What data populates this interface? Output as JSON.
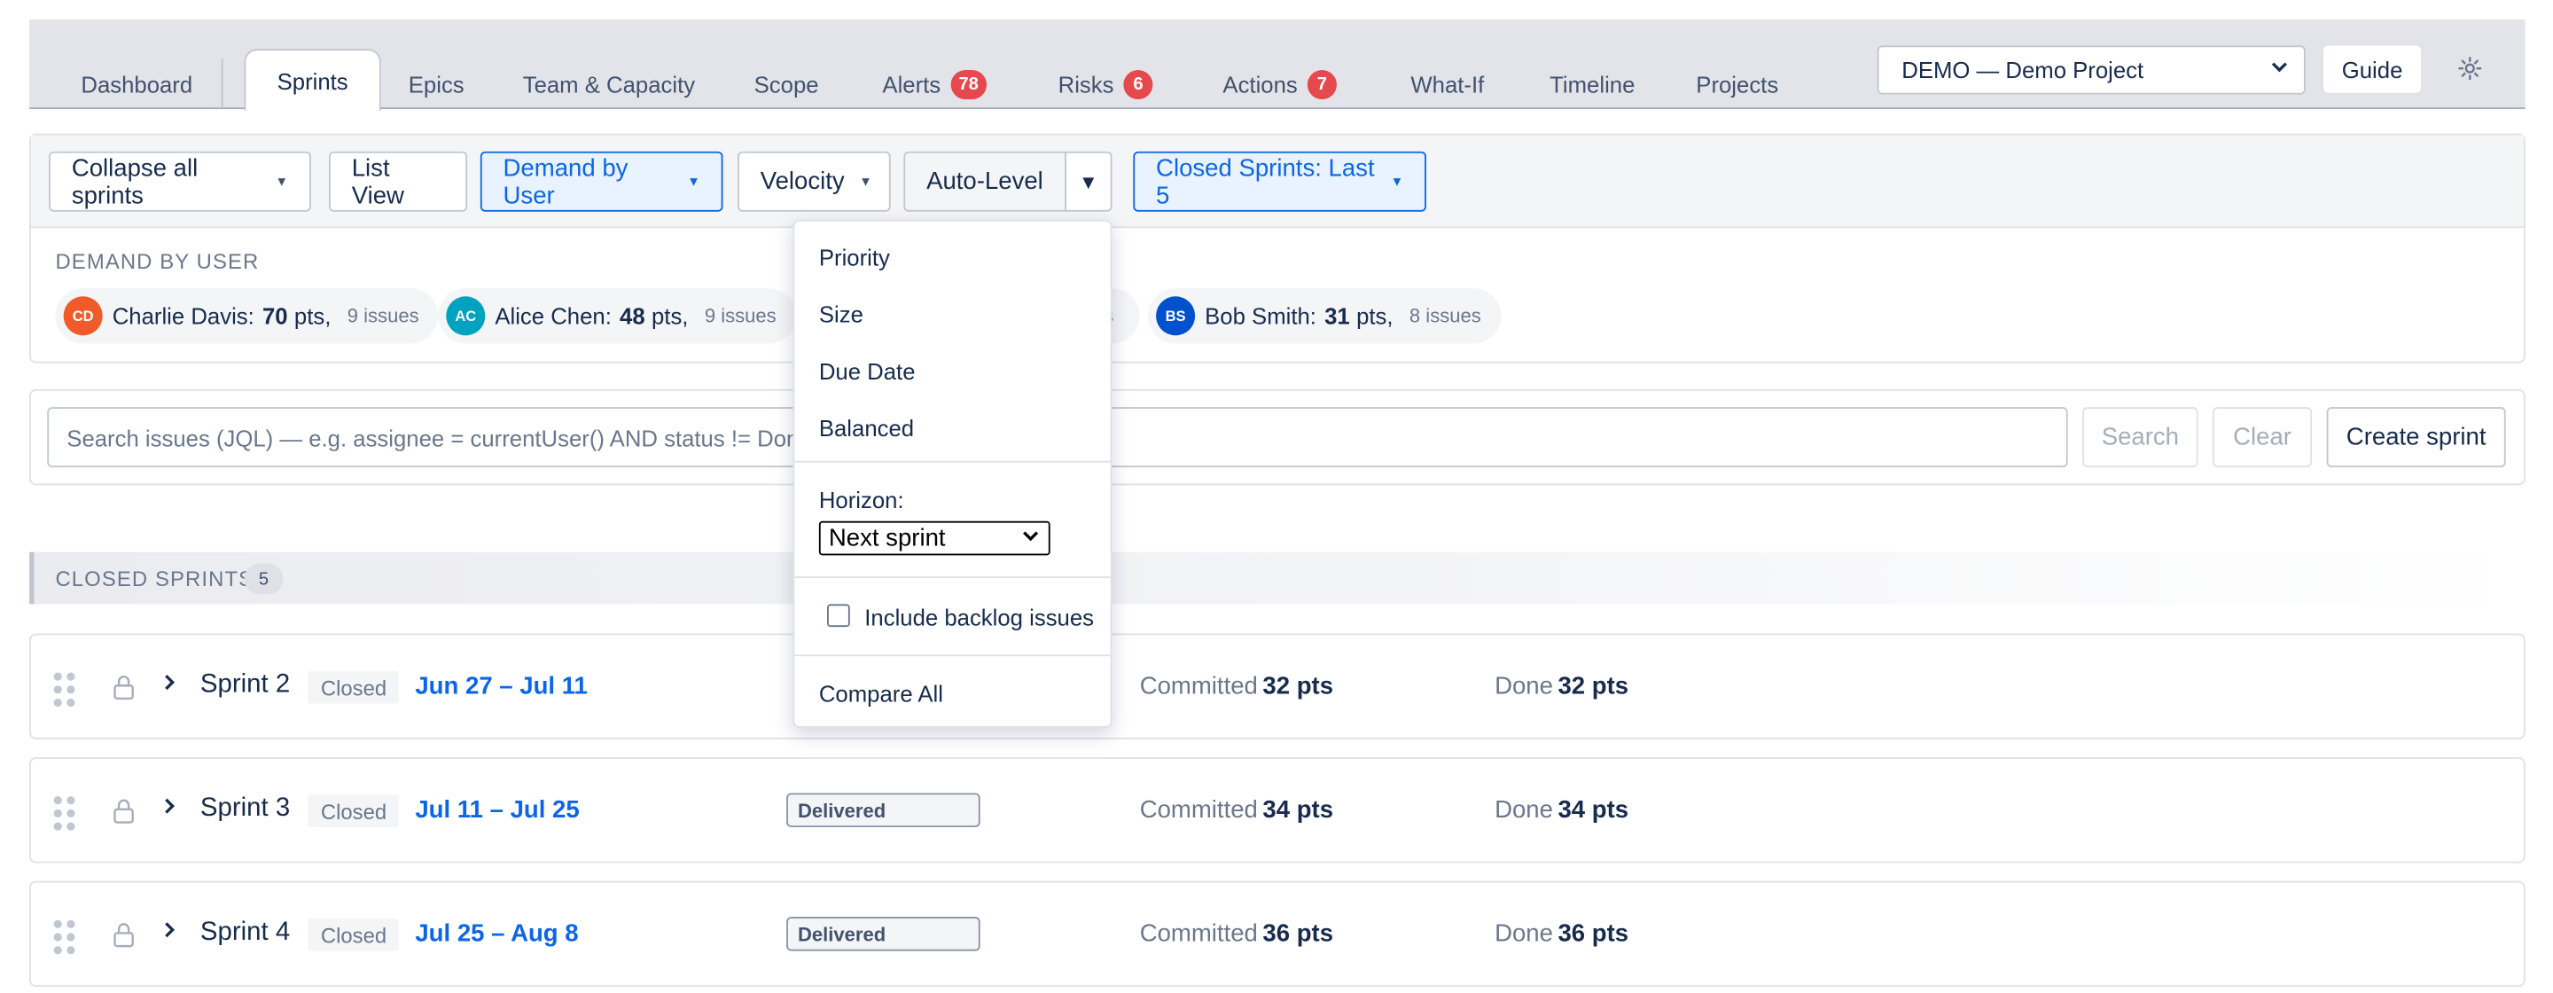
{
  "tabs": [
    {
      "label": "Dashboard",
      "badge": ""
    },
    {
      "label": "Sprints",
      "badge": ""
    },
    {
      "label": "Epics",
      "badge": ""
    },
    {
      "label": "Team & Capacity",
      "badge": ""
    },
    {
      "label": "Scope",
      "badge": ""
    },
    {
      "label": "Alerts",
      "badge": "78"
    },
    {
      "label": "Risks",
      "badge": "6"
    },
    {
      "label": "Actions",
      "badge": "7"
    },
    {
      "label": "What-If",
      "badge": ""
    },
    {
      "label": "Timeline",
      "badge": ""
    },
    {
      "label": "Projects",
      "badge": ""
    }
  ],
  "active_tab": "Sprints",
  "header": {
    "project_select": "DEMO — Demo Project",
    "guide_label": "Guide"
  },
  "toolbar": {
    "collapse_label": "Collapse all sprints",
    "list_view_label": "List View",
    "demand_label": "Demand by User",
    "velocity_label": "Velocity",
    "auto_level_label": "Auto-Level",
    "closed_sprints_label": "Closed Sprints: Last 5"
  },
  "demand": {
    "title": "DEMAND BY USER",
    "users": [
      {
        "initials": "CD",
        "name": "Charlie Davis:",
        "pts": "70",
        "unit": "pts,",
        "issues": "9 issues",
        "color": "#f15b2a"
      },
      {
        "initials": "AC",
        "name": "Alice Chen:",
        "pts": "48",
        "unit": "pts,",
        "issues": "9 issues",
        "color": "#00a3bf"
      },
      {
        "partial": "s"
      },
      {
        "initials": "BS",
        "name": "Bob Smith:",
        "pts": "31",
        "unit": "pts,",
        "issues": "8 issues",
        "color": "#0052cc"
      }
    ]
  },
  "search": {
    "placeholder": "Search issues (JQL) — e.g. assignee = currentUser() AND status != Done",
    "search_label": "Search",
    "clear_label": "Clear",
    "create_label": "Create sprint"
  },
  "closed_sprints": {
    "title": "CLOSED SPRINTS",
    "count": "5"
  },
  "sprints": [
    {
      "name": "Sprint 2",
      "status": "Closed",
      "dates": "Jun 27 – Jul 11",
      "badge": "",
      "committed_label": "Committed",
      "committed": "32 pts",
      "done_label": "Done",
      "done": "32 pts"
    },
    {
      "name": "Sprint 3",
      "status": "Closed",
      "dates": "Jul 11 – Jul 25",
      "badge": "Delivered",
      "committed_label": "Committed",
      "committed": "34 pts",
      "done_label": "Done",
      "done": "34 pts"
    },
    {
      "name": "Sprint 4",
      "status": "Closed",
      "dates": "Jul 25 – Aug 8",
      "badge": "Delivered",
      "committed_label": "Committed",
      "committed": "36 pts",
      "done_label": "Done",
      "done": "36 pts"
    }
  ],
  "menu": {
    "priority": "Priority",
    "size": "Size",
    "due_date": "Due Date",
    "balanced": "Balanced",
    "horizon_label": "Horizon:",
    "horizon_value": "Next sprint",
    "backlog_label": "Include backlog issues",
    "compare_all": "Compare All"
  },
  "colors": {
    "accent": "#0c66e4",
    "badge_red": "#e5484d"
  }
}
